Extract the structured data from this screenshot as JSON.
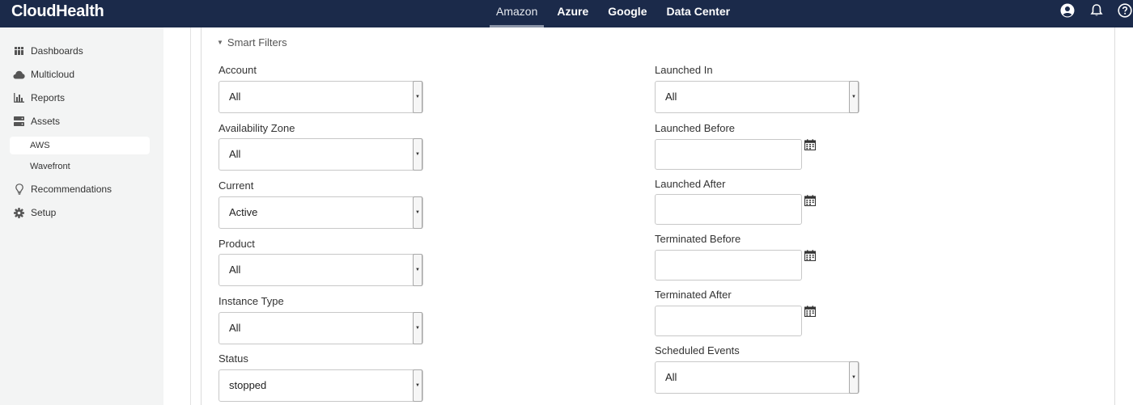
{
  "app": {
    "name": "CloudHealth"
  },
  "tabs": [
    {
      "label": "Amazon",
      "active": true
    },
    {
      "label": "Azure",
      "active": false
    },
    {
      "label": "Google",
      "active": false
    },
    {
      "label": "Data Center",
      "active": false
    }
  ],
  "top_icons": [
    "user-icon",
    "bell-icon",
    "help-icon"
  ],
  "sidebar": {
    "items": [
      {
        "label": "Dashboards",
        "icon": "dashboard-grid-icon"
      },
      {
        "label": "Multicloud",
        "icon": "cloud-icon"
      },
      {
        "label": "Reports",
        "icon": "bar-chart-icon"
      },
      {
        "label": "Assets",
        "icon": "server-icon"
      },
      {
        "label": "Recommendations",
        "icon": "lightbulb-icon"
      },
      {
        "label": "Setup",
        "icon": "gear-icon"
      }
    ],
    "subitems": [
      {
        "label": "AWS",
        "active": true
      },
      {
        "label": "Wavefront",
        "active": false
      }
    ]
  },
  "smart_filters": {
    "title": "Smart Filters",
    "left": [
      {
        "label": "Account",
        "value": "All"
      },
      {
        "label": "Availability Zone",
        "value": "All"
      },
      {
        "label": "Current",
        "value": "Active"
      },
      {
        "label": "Product",
        "value": "All"
      },
      {
        "label": "Instance Type",
        "value": "All"
      },
      {
        "label": "Status",
        "value": "stopped"
      }
    ],
    "right": {
      "launched_in": {
        "label": "Launched In",
        "value": "All"
      },
      "launched_before": {
        "label": "Launched Before",
        "value": ""
      },
      "launched_after": {
        "label": "Launched After",
        "value": ""
      },
      "terminated_before": {
        "label": "Terminated Before",
        "value": ""
      },
      "terminated_after": {
        "label": "Terminated After",
        "value": ""
      },
      "scheduled_events": {
        "label": "Scheduled Events",
        "value": "All"
      }
    }
  },
  "colors": {
    "topbar": "#1b2a4a",
    "sidebar": "#f3f4f4"
  }
}
